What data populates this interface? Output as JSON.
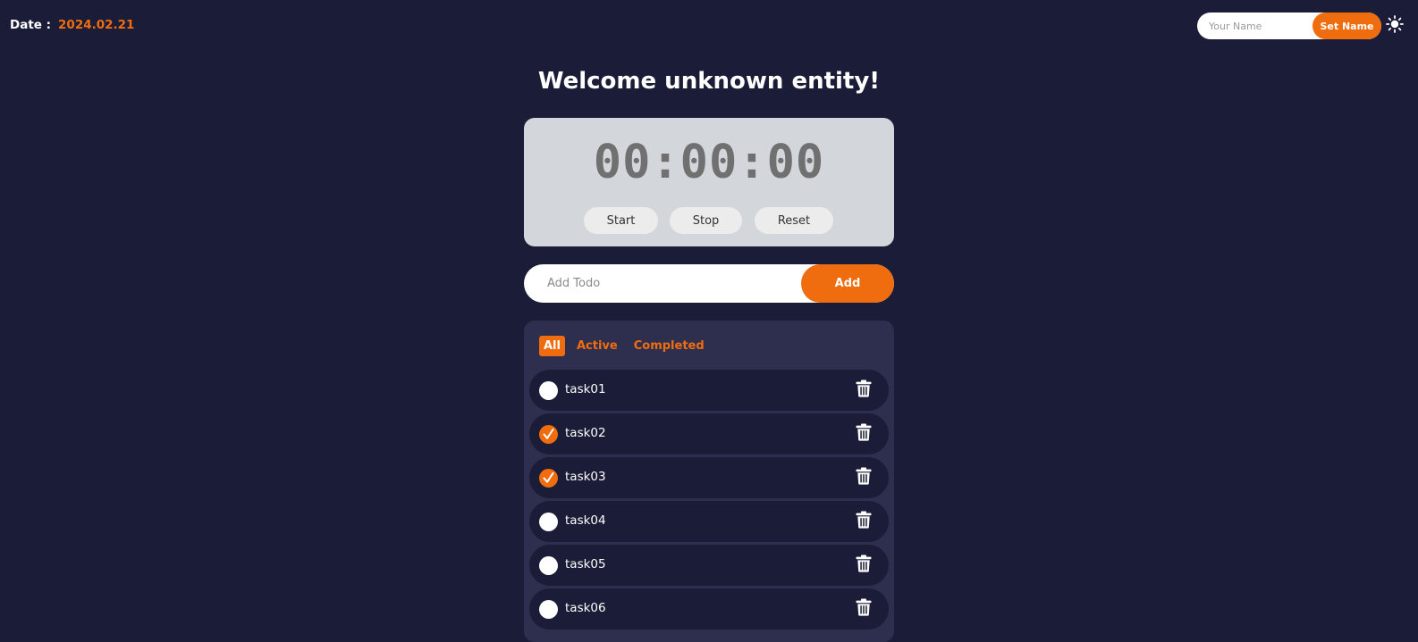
{
  "header": {
    "date_label": "Date :",
    "date_value": "2024.02.21",
    "name_placeholder": "Your Name",
    "set_name_label": "Set Name",
    "theme_icon": "sun-icon"
  },
  "welcome": "Welcome unknown entity!",
  "timer": {
    "display": "00:00:00",
    "start_label": "Start",
    "stop_label": "Stop",
    "reset_label": "Reset"
  },
  "add_todo": {
    "placeholder": "Add Todo",
    "button_label": "Add"
  },
  "filters": [
    {
      "label": "All",
      "selected": true
    },
    {
      "label": "Active",
      "selected": false
    },
    {
      "label": "Completed",
      "selected": false
    }
  ],
  "todos": [
    {
      "text": "task01",
      "done": false
    },
    {
      "text": "task02",
      "done": true
    },
    {
      "text": "task03",
      "done": true
    },
    {
      "text": "task04",
      "done": false
    },
    {
      "text": "task05",
      "done": false
    },
    {
      "text": "task06",
      "done": false
    }
  ],
  "colors": {
    "background": "#1b1c37",
    "accent": "#f06d0f",
    "panel": "#2e2f4e",
    "timer_card": "#d3d7dc"
  }
}
